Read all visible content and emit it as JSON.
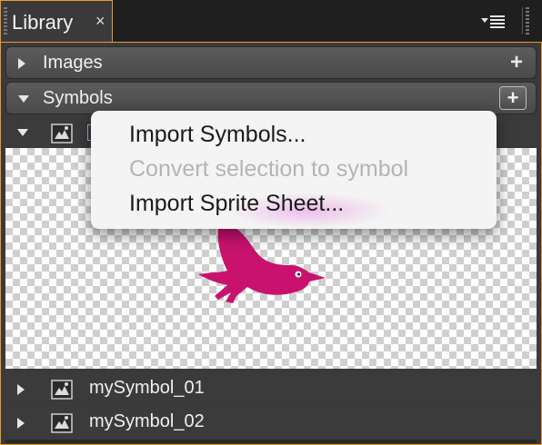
{
  "tab": {
    "label": "Library",
    "close": "×"
  },
  "sections": {
    "images": {
      "title": "Images",
      "add": "+"
    },
    "symbols": {
      "title": "Symbols",
      "add": "+"
    }
  },
  "symbols_list": [
    {
      "name": "mySymbol_01"
    },
    {
      "name": "mySymbol_02"
    }
  ],
  "context_menu": {
    "items": [
      {
        "label": "Import Symbols...",
        "enabled": true
      },
      {
        "label": "Convert selection to symbol",
        "enabled": false
      },
      {
        "label": "Import Sprite Sheet...",
        "enabled": true
      }
    ]
  },
  "colors": {
    "accent": "#e89a2c",
    "bird": "#c8126e",
    "panel_bg": "#3a3a3a"
  },
  "icons": {
    "panel_menu": "panel-menu-icon",
    "expand": "triangle-right-icon",
    "collapse": "triangle-down-icon",
    "symbol": "symbol-icon"
  }
}
